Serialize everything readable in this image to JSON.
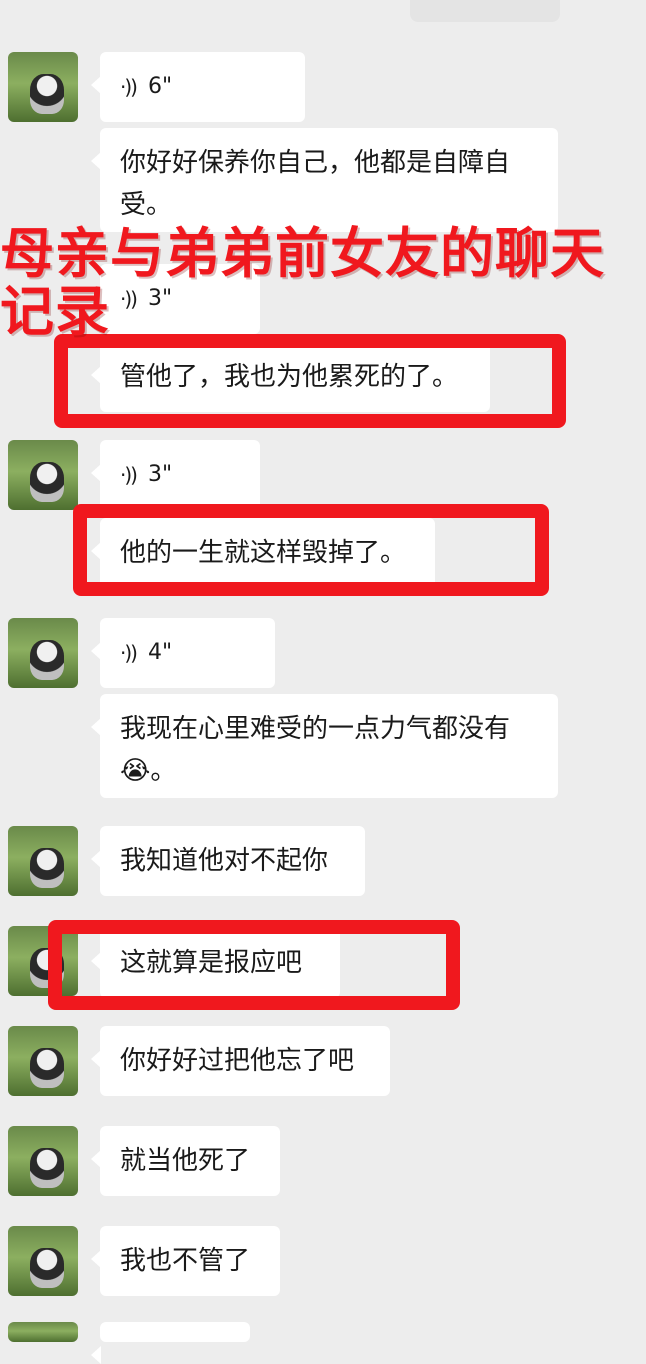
{
  "overlay": {
    "title_line1": "母亲与弟弟前女友的聊天",
    "title_line2": "记录"
  },
  "messages": [
    {
      "type": "voice",
      "duration": "6\""
    },
    {
      "type": "text",
      "text": "你好好保养你自己，他都是自障自受。"
    },
    {
      "type": "voice",
      "duration": "3\""
    },
    {
      "type": "text",
      "text": "管他了，我也为他累死的了。"
    },
    {
      "type": "voice",
      "duration": "3\""
    },
    {
      "type": "text",
      "text": "他的一生就这样毁掉了。"
    },
    {
      "type": "voice",
      "duration": "4\""
    },
    {
      "type": "text",
      "text": "我现在心里难受的一点力气都没有😭。"
    },
    {
      "type": "text",
      "text": "我知道他对不起你"
    },
    {
      "type": "text",
      "text": "这就算是报应吧"
    },
    {
      "type": "text",
      "text": "你好好过把他忘了吧"
    },
    {
      "type": "text",
      "text": "就当他死了"
    },
    {
      "type": "text",
      "text": "我也不管了"
    }
  ],
  "icons": {
    "voice": "voice-wave-icon",
    "avatar": "dog-avatar"
  },
  "colors": {
    "highlight": "#f0181e",
    "bubble": "#ffffff",
    "background": "#ededed"
  }
}
